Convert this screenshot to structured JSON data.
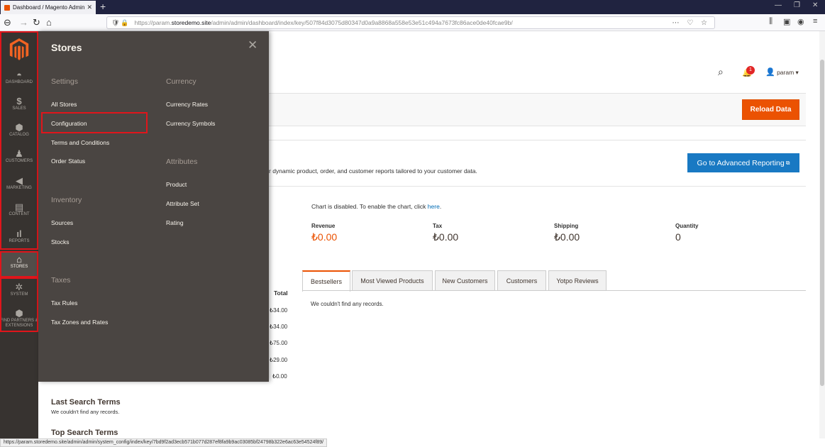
{
  "browser": {
    "tab_title": "Dashboard / Magento Admin",
    "tab_close": "✕",
    "new_tab": "+",
    "url_prefix": "https://param.",
    "url_domain": "storedemo.site",
    "url_path": "/admin/admin/dashboard/index/key/507f84d3075d80347d0a9a8868a558e53e51c494a7673fc86ace0de40fcae9b/",
    "status_url": "https://param.storedemo.site/admin/admin/system_config/index/key/7bd9f2ad3ecb571b077d287ef8fa9b9ac03085bf24798b322e6ac63e54524f89/"
  },
  "sidebar": {
    "items": [
      {
        "label": "DASHBOARD",
        "icon": "speedometer-icon"
      },
      {
        "label": "SALES",
        "icon": "dollar-icon"
      },
      {
        "label": "CATALOG",
        "icon": "box-icon"
      },
      {
        "label": "CUSTOMERS",
        "icon": "person-icon"
      },
      {
        "label": "MARKETING",
        "icon": "megaphone-icon"
      },
      {
        "label": "CONTENT",
        "icon": "layout-icon"
      },
      {
        "label": "REPORTS",
        "icon": "bar-chart-icon"
      },
      {
        "label": "STORES",
        "icon": "storefront-icon"
      },
      {
        "label": "SYSTEM",
        "icon": "gear-icon"
      },
      {
        "label": "FIND PARTNERS & EXTENSIONS",
        "icon": "box-icon"
      }
    ]
  },
  "flyout": {
    "title": "Stores",
    "close": "✕",
    "settings": {
      "heading": "Settings",
      "links": [
        "All Stores",
        "Configuration",
        "Terms and Conditions",
        "Order Status"
      ]
    },
    "inventory": {
      "heading": "Inventory",
      "links": [
        "Sources",
        "Stocks"
      ]
    },
    "taxes": {
      "heading": "Taxes",
      "links": [
        "Tax Rules",
        "Tax Zones and Rates"
      ]
    },
    "currency": {
      "heading": "Currency",
      "links": [
        "Currency Rates",
        "Currency Symbols"
      ]
    },
    "attributes": {
      "heading": "Attributes",
      "links": [
        "Product",
        "Attribute Set",
        "Rating"
      ]
    }
  },
  "header": {
    "notification_count": "1",
    "user": "param ▾"
  },
  "main": {
    "reload_label": "Reload Data",
    "advanced_reporting_label": "Go to Advanced Reporting",
    "advanced_text": "r dynamic product, order, and customer reports tailored to your customer data.",
    "chart_note": "Chart is disabled. To enable the chart, click ",
    "chart_link": "here",
    "metrics": [
      {
        "label": "Revenue",
        "value": "₺0.00"
      },
      {
        "label": "Tax",
        "value": "₺0.00"
      },
      {
        "label": "Shipping",
        "value": "₺0.00"
      },
      {
        "label": "Quantity",
        "value": "0"
      }
    ],
    "tabs": [
      "Bestsellers",
      "Most Viewed Products",
      "New Customers",
      "Customers",
      "Yotpo Reviews"
    ],
    "no_records": "We couldn't find any records.",
    "total_header": "Total",
    "totals": [
      "₺34.00",
      "₺34.00",
      "₺75.00",
      "₺29.00",
      "₺0.00"
    ],
    "last_search_title": "Last Search Terms",
    "last_search_text": "We couldn't find any records.",
    "top_search_title": "Top Search Terms"
  },
  "colors": {
    "accent": "#eb5202",
    "primary_blue": "#1979c3",
    "sidebar_bg": "#373330",
    "flyout_bg": "#4a4542",
    "highlight_border": "#e0151b"
  }
}
